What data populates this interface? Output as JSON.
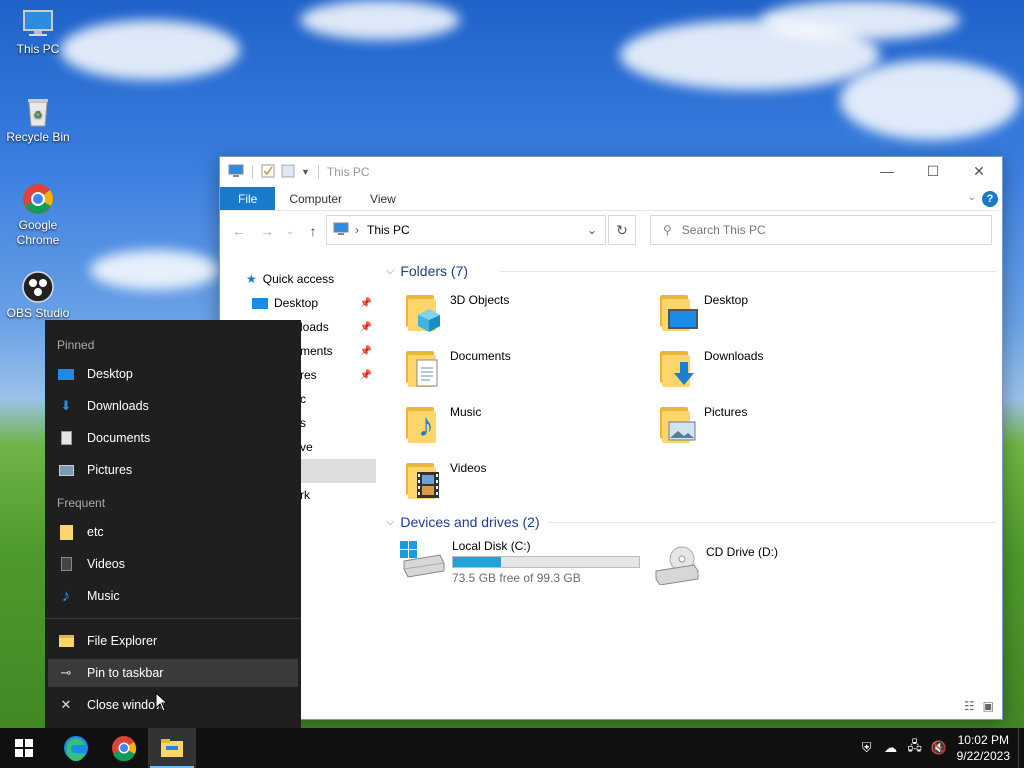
{
  "desktop": {
    "icons": [
      {
        "label": "This PC"
      },
      {
        "label": "Recycle Bin"
      },
      {
        "label": "Google Chrome"
      },
      {
        "label": "OBS Studio"
      }
    ]
  },
  "explorer": {
    "title": "This PC",
    "ribbon_tabs": [
      "File",
      "Computer",
      "View"
    ],
    "address": "This PC",
    "search_placeholder": "Search This PC",
    "nav_pane": {
      "quick_access": "Quick access",
      "items": [
        {
          "label": "Desktop"
        },
        {
          "label": "loads"
        },
        {
          "label": "ments"
        },
        {
          "label": "res"
        },
        {
          "label": "c"
        },
        {
          "label": "s"
        },
        {
          "label": "ve"
        },
        {
          "label": ""
        },
        {
          "label": "rk"
        }
      ]
    },
    "folders_header": "Folders (7)",
    "folders": [
      {
        "label": "3D Objects",
        "icon": "3d-objects-folder-icon"
      },
      {
        "label": "Desktop",
        "icon": "desktop-folder-icon"
      },
      {
        "label": "Documents",
        "icon": "documents-folder-icon"
      },
      {
        "label": "Downloads",
        "icon": "downloads-folder-icon"
      },
      {
        "label": "Music",
        "icon": "music-folder-icon"
      },
      {
        "label": "Pictures",
        "icon": "pictures-folder-icon"
      },
      {
        "label": "Videos",
        "icon": "videos-folder-icon"
      }
    ],
    "drives_header": "Devices and drives (2)",
    "drives": [
      {
        "label": "Local Disk (C:)",
        "free_text": "73.5 GB free of 99.3 GB",
        "used_fraction": 0.26
      },
      {
        "label": "CD Drive (D:)"
      }
    ]
  },
  "jumplist": {
    "pinned_header": "Pinned",
    "pinned": [
      "Desktop",
      "Downloads",
      "Documents",
      "Pictures"
    ],
    "frequent_header": "Frequent",
    "frequent": [
      "etc",
      "Videos",
      "Music"
    ],
    "actions": [
      "File Explorer",
      "Pin to taskbar",
      "Close window"
    ]
  },
  "taskbar": {
    "time": "10:02 PM",
    "date": "9/22/2023"
  },
  "colors": {
    "accent": "#1979ca",
    "folder": "#fcd66b",
    "drive_bar": "#26a0da",
    "header_text": "#1e3d8f"
  }
}
